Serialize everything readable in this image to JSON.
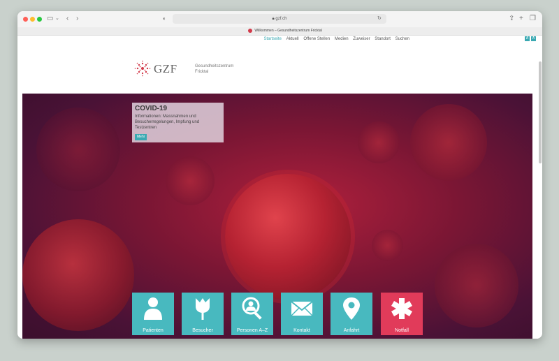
{
  "browser": {
    "url": "gzf.ch",
    "tab_title": "Willkommen – Gesundheitszentrum Fricktal"
  },
  "topnav": {
    "items": [
      "Startseite",
      "Aktuell",
      "Offene Stellen",
      "Medien",
      "Zuweiser",
      "Standort",
      "Suchen"
    ],
    "active": "Startseite",
    "font_buttons": [
      "A",
      "A"
    ]
  },
  "logo": {
    "text": "GZF",
    "subtitle_line1": "Gesundheitszentrum",
    "subtitle_line2": "Fricktal"
  },
  "covid": {
    "title": "COVID-19",
    "text": "Informationen: Massnahmen und Besucherregelungen, Impfung und Testzentren",
    "button": "Mehr"
  },
  "tiles": [
    {
      "label": "Patienten",
      "icon": "person-icon",
      "color": "#48b9bf"
    },
    {
      "label": "Besucher",
      "icon": "tulip-icon",
      "color": "#48b9bf"
    },
    {
      "label": "Personen A–Z",
      "icon": "magnifier-person-icon",
      "color": "#48b9bf"
    },
    {
      "label": "Kontakt",
      "icon": "envelope-icon",
      "color": "#48b9bf"
    },
    {
      "label": "Anfahrt",
      "icon": "map-pin-icon",
      "color": "#48b9bf"
    },
    {
      "label": "Notfall",
      "icon": "asterisk-icon",
      "color": "#e13b5a"
    }
  ],
  "colors": {
    "accent": "#3aa9b2",
    "emergency": "#e13b5a"
  }
}
